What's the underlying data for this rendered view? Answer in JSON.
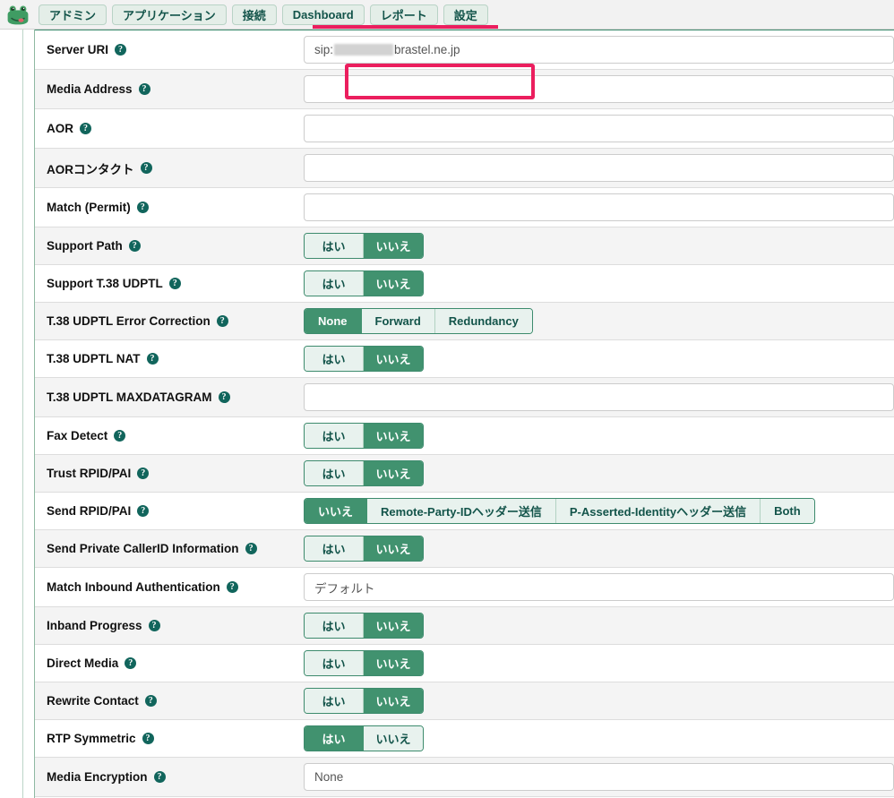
{
  "topbar": {
    "logo_name": "frog-logo",
    "tabs": [
      {
        "label": "アドミン",
        "name": "tab-admin"
      },
      {
        "label": "アプリケーション",
        "name": "tab-applications"
      },
      {
        "label": "接続",
        "name": "tab-connectivity"
      },
      {
        "label": "Dashboard",
        "name": "tab-dashboard"
      },
      {
        "label": "レポート",
        "name": "tab-reports"
      },
      {
        "label": "設定",
        "name": "tab-settings"
      }
    ]
  },
  "colors": {
    "accent_green": "#41926f",
    "accent_green_light": "#e8f2ee",
    "teal_text": "#13544a",
    "highlight_pink": "#eb1e5e",
    "row_alt": "#f4f4f4"
  },
  "labels": {
    "yes": "はい",
    "no": "いいえ"
  },
  "form": {
    "rows": [
      {
        "name": "server-uri",
        "label": "Server URI",
        "type": "text",
        "value_prefix": "sip:",
        "value_suffix": "brastel.ne.jp",
        "redacted": true,
        "highlighted": true
      },
      {
        "name": "media-address",
        "label": "Media Address",
        "type": "text",
        "value": ""
      },
      {
        "name": "aor",
        "label": "AOR",
        "type": "text",
        "value": ""
      },
      {
        "name": "aor-contact",
        "label": "AORコンタクト",
        "type": "text",
        "value": ""
      },
      {
        "name": "match-permit",
        "label": "Match (Permit)",
        "type": "text",
        "value": ""
      },
      {
        "name": "support-path",
        "label": "Support Path",
        "type": "segment",
        "options": [
          "はい",
          "いいえ"
        ],
        "selected": 1
      },
      {
        "name": "support-t38-udptl",
        "label": "Support T.38 UDPTL",
        "type": "segment",
        "options": [
          "はい",
          "いいえ"
        ],
        "selected": 1
      },
      {
        "name": "t38-udptl-error-correction",
        "label": "T.38 UDPTL Error Correction",
        "type": "segment",
        "options": [
          "None",
          "Forward",
          "Redundancy"
        ],
        "selected": 0
      },
      {
        "name": "t38-udptl-nat",
        "label": "T.38 UDPTL NAT",
        "type": "segment",
        "options": [
          "はい",
          "いいえ"
        ],
        "selected": 1
      },
      {
        "name": "t38-udptl-maxdatagram",
        "label": "T.38 UDPTL MAXDATAGRAM",
        "type": "text",
        "value": ""
      },
      {
        "name": "fax-detect",
        "label": "Fax Detect",
        "type": "segment",
        "options": [
          "はい",
          "いいえ"
        ],
        "selected": 1
      },
      {
        "name": "trust-rpid-pai",
        "label": "Trust RPID/PAI",
        "type": "segment",
        "options": [
          "はい",
          "いいえ"
        ],
        "selected": 1
      },
      {
        "name": "send-rpid-pai",
        "label": "Send RPID/PAI",
        "type": "segment",
        "options": [
          "いいえ",
          "Remote-Party-IDヘッダー送信",
          "P-Asserted-Identityヘッダー送信",
          "Both"
        ],
        "selected": 0
      },
      {
        "name": "send-private-callerid-information",
        "label": "Send Private CallerID Information",
        "type": "segment",
        "options": [
          "はい",
          "いいえ"
        ],
        "selected": 1
      },
      {
        "name": "match-inbound-authentication",
        "label": "Match Inbound Authentication",
        "type": "select",
        "value": "デフォルト"
      },
      {
        "name": "inband-progress",
        "label": "Inband Progress",
        "type": "segment",
        "options": [
          "はい",
          "いいえ"
        ],
        "selected": 1
      },
      {
        "name": "direct-media",
        "label": "Direct Media",
        "type": "segment",
        "options": [
          "はい",
          "いいえ"
        ],
        "selected": 1
      },
      {
        "name": "rewrite-contact",
        "label": "Rewrite Contact",
        "type": "segment",
        "options": [
          "はい",
          "いいえ"
        ],
        "selected": 1
      },
      {
        "name": "rtp-symmetric",
        "label": "RTP Symmetric",
        "type": "segment",
        "options": [
          "はい",
          "いいえ"
        ],
        "selected": 0
      },
      {
        "name": "media-encryption",
        "label": "Media Encryption",
        "type": "select",
        "value": "None"
      }
    ]
  }
}
